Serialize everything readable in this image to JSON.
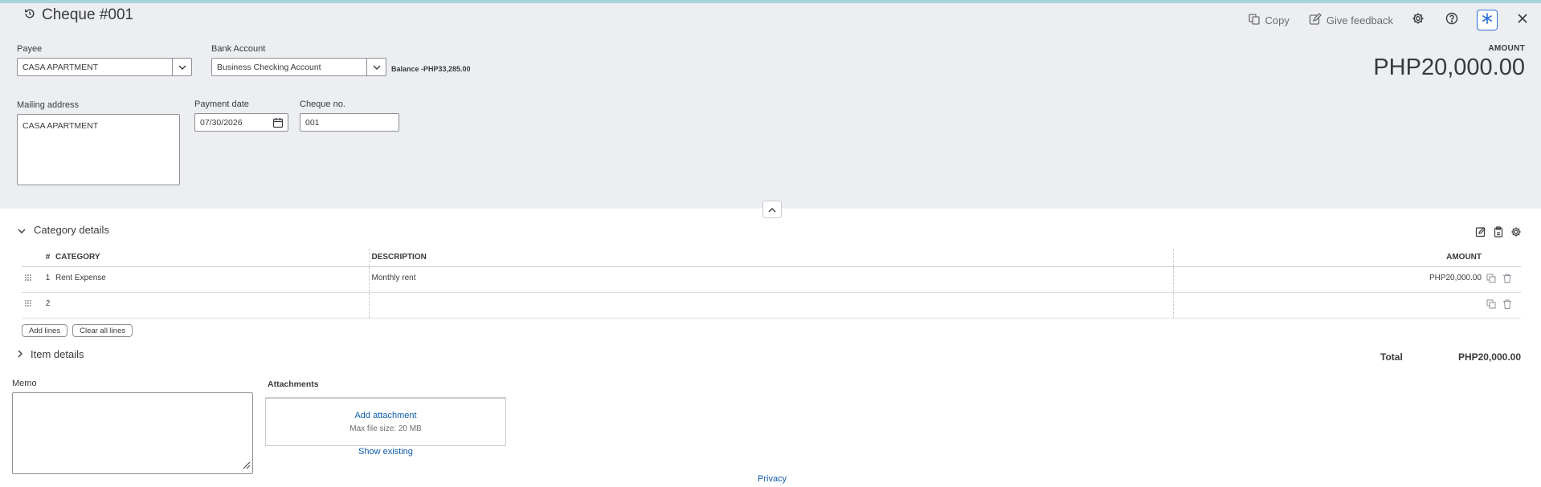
{
  "header": {
    "title": "Cheque #001",
    "copy_label": "Copy",
    "feedback_label": "Give feedback"
  },
  "payee": {
    "label": "Payee",
    "value": "CASA APARTMENT"
  },
  "bank_account": {
    "label": "Bank Account",
    "value": "Business Checking Account",
    "balance": "Balance -PHP33,285.00"
  },
  "mailing_address": {
    "label": "Mailing address",
    "value": "CASA APARTMENT"
  },
  "payment_date": {
    "label": "Payment date",
    "value": "07/30/2026"
  },
  "cheque_no": {
    "label": "Cheque no.",
    "value": "001"
  },
  "amount": {
    "label": "AMOUNT",
    "value": "PHP20,000.00"
  },
  "category_details": {
    "title": "Category details",
    "columns": {
      "num": "#",
      "category": "CATEGORY",
      "description": "DESCRIPTION",
      "amount": "AMOUNT"
    },
    "rows": [
      {
        "num": "1",
        "category": "Rent Expense",
        "description": "Monthly rent",
        "amount": "PHP20,000.00"
      },
      {
        "num": "2",
        "category": "",
        "description": "",
        "amount": ""
      }
    ],
    "add_lines_label": "Add lines",
    "clear_lines_label": "Clear all lines"
  },
  "item_details": {
    "title": "Item details"
  },
  "total": {
    "label": "Total",
    "value": "PHP20,000.00"
  },
  "memo": {
    "label": "Memo"
  },
  "attachments": {
    "label": "Attachments",
    "add_label": "Add attachment",
    "max_size": "Max file size: 20 MB",
    "show_existing": "Show existing"
  },
  "footer": {
    "privacy": "Privacy"
  },
  "colors": {
    "accent": "#2c6fdb",
    "link": "#0d5cab",
    "header_bg": "#eceef1",
    "top_strip": "#a7d3d9"
  }
}
